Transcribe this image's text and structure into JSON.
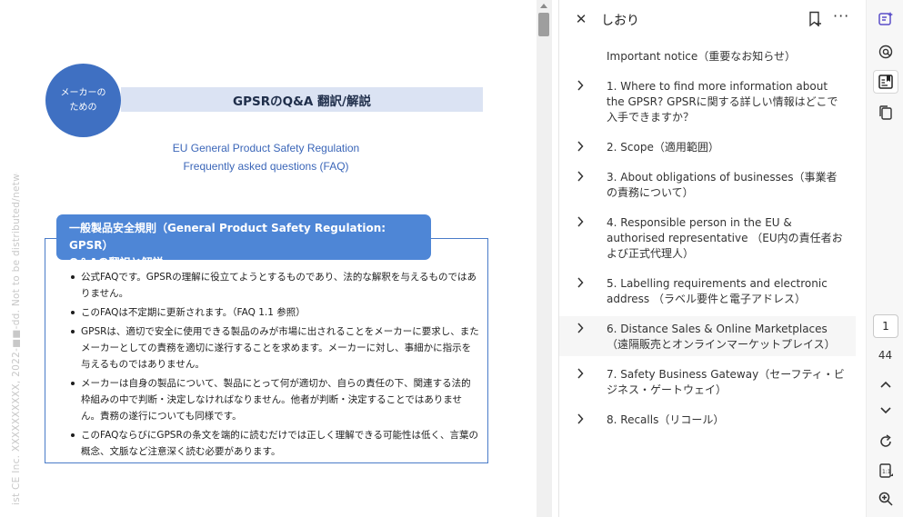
{
  "document": {
    "watermark": "ist CE Inc. XXXXXXXXXX, 2022-■■-dd. Not to be distributed/networked.",
    "maker_circle": {
      "line1": "メーカーの",
      "line2": "ための"
    },
    "title": "GPSRのQ&A 翻訳/解説",
    "subtitle_line1": "EU General Product Safety Regulation",
    "subtitle_line2": "Frequently asked questions (FAQ)",
    "info_header_line1": "一般製品安全規則（General Product Safety Regulation: GPSR）",
    "info_header_line2": "Q＆Aの翻訳と解説",
    "bullets": [
      "公式FAQです。GPSRの理解に役立てようとするものであり、法的な解釈を与えるものではありません。",
      "このFAQは不定期に更新されます。（FAQ 1.1 参照）",
      "GPSRは、適切で安全に使用できる製品のみが市場に出されることをメーカーに要求し、またメーカーとしての責務を適切に遂行することを求めます。メーカーに対し、事細かに指示を与えるものではありません。",
      "メーカーは自身の製品について、製品にとって何が適切か、自らの責任の下、関連する法的枠組みの中で判断・決定しなければなりません。他者が判断・決定することではありません。責務の遂行についても同様です。",
      "このFAQならびにGPSRの条文を端的に読むだけでは正しく理解できる可能性は低く、言葉の概念、文脈など注意深く読む必要があります。"
    ]
  },
  "panel": {
    "close_icon": "close-icon",
    "title": "しおり",
    "add_bookmark_icon": "bookmark-add-icon",
    "more_icon": "more-options-icon",
    "more_label": "···",
    "items": [
      {
        "label": "Important notice（重要なお知らせ）",
        "expandable": false
      },
      {
        "label": "1. Where to find more information about the GPSR? GPSRに関する詳しい情報はどこで入手できますか？",
        "expandable": true
      },
      {
        "label": "2. Scope（適用範囲）",
        "expandable": true
      },
      {
        "label": "3. About obligations of businesses（事業者の責務について）",
        "expandable": true
      },
      {
        "label": "4. Responsible person in the EU & authorised representative （EU内の責任者および正式代理人）",
        "expandable": true
      },
      {
        "label": "5. Labelling requirements and electronic address （ラベル要件と電子アドレス）",
        "expandable": true
      },
      {
        "label": "6. Distance Sales & Online Marketplaces （遠隔販売とオンラインマーケットプレイス）",
        "expandable": true
      },
      {
        "label": "7. Safety Business Gateway（セーフティ・ビジネス・ゲートウェイ）",
        "expandable": true
      },
      {
        "label": "8. Recalls（リコール）",
        "expandable": true
      }
    ]
  },
  "toolbar": {
    "current_page": "1",
    "total_pages": "44",
    "accent_color": "#5b4fc9",
    "icons": [
      "ai-assistant-icon",
      "copilot-icon",
      "bookmarks-icon",
      "copy-pages-icon",
      "chevron-up-icon",
      "chevron-down-icon",
      "rotate-icon",
      "page-fit-icon",
      "zoom-in-icon"
    ]
  }
}
